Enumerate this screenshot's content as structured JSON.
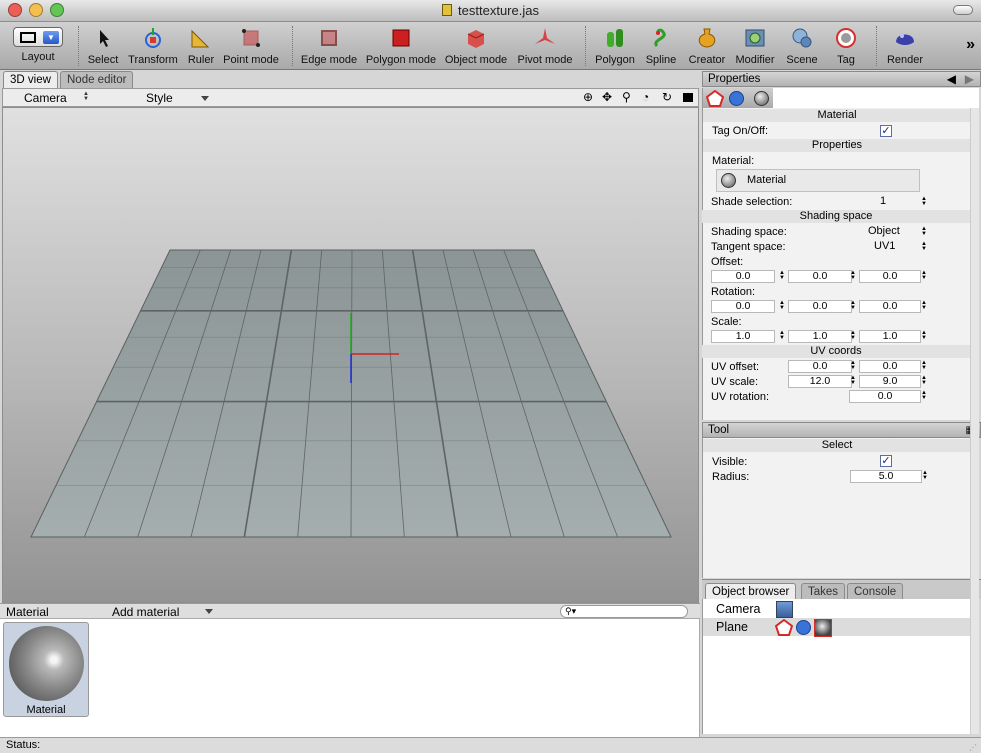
{
  "window": {
    "title": "testtexture.jas",
    "buttons": {
      "close_color": "#ec5f57",
      "minimize_color": "#f4bf4f",
      "zoom_color": "#62c554"
    }
  },
  "toolbar": {
    "items": [
      {
        "label": "Layout",
        "icon": "layout-icon"
      },
      {
        "label": "Select",
        "icon": "cursor-icon"
      },
      {
        "label": "Transform",
        "icon": "transform-icon"
      },
      {
        "label": "Ruler",
        "icon": "ruler-icon"
      },
      {
        "label": "Point mode",
        "icon": "point-mode-icon"
      },
      {
        "label": "Edge mode",
        "icon": "edge-mode-icon"
      },
      {
        "label": "Polygon mode",
        "icon": "polygon-mode-icon"
      },
      {
        "label": "Object mode",
        "icon": "object-mode-icon"
      },
      {
        "label": "Pivot mode",
        "icon": "pivot-mode-icon"
      },
      {
        "label": "Polygon",
        "icon": "polygon-icon"
      },
      {
        "label": "Spline",
        "icon": "spline-icon"
      },
      {
        "label": "Creator",
        "icon": "creator-icon"
      },
      {
        "label": "Modifier",
        "icon": "modifier-icon"
      },
      {
        "label": "Scene",
        "icon": "scene-icon"
      },
      {
        "label": "Tag",
        "icon": "tag-icon"
      },
      {
        "label": "Render",
        "icon": "render-icon"
      }
    ],
    "overflow": "»"
  },
  "left_tabs": {
    "view_3d": "3D view",
    "node_editor": "Node editor"
  },
  "view_header": {
    "camera": "Camera",
    "style": "Style"
  },
  "material_panel": {
    "header": "Material",
    "add": "Add material",
    "search_icon": "search-icon",
    "items": [
      {
        "label": "Material"
      }
    ]
  },
  "status": {
    "label": "Status:"
  },
  "properties": {
    "title": "Properties",
    "back_icon": "arrow-left-icon",
    "forward_icon": "arrow-right-icon",
    "sections": {
      "material": "Material",
      "properties": "Properties",
      "shading_space": "Shading space",
      "uv_coords": "UV coords"
    },
    "tag_onoff": "Tag On/Off:",
    "material_label": "Material:",
    "material_value": "Material",
    "shade_selection_label": "Shade selection:",
    "shade_selection_value": "1",
    "shading_space_label": "Shading space:",
    "shading_space_value": "Object",
    "tangent_space_label": "Tangent space:",
    "tangent_space_value": "UV1",
    "offset_label": "Offset:",
    "offset": [
      "0.0",
      "0.0",
      "0.0"
    ],
    "rotation_label": "Rotation:",
    "rotation": [
      "0.0",
      "0.0",
      "0.0"
    ],
    "scale_label": "Scale:",
    "scale": [
      "1.0",
      "1.0",
      "1.0"
    ],
    "uv_offset_label": "UV offset:",
    "uv_offset": [
      "0.0",
      "0.0"
    ],
    "uv_scale_label": "UV scale:",
    "uv_scale": [
      "12.0",
      "9.0"
    ],
    "uv_rotation_label": "UV rotation:",
    "uv_rotation": "0.0"
  },
  "tool": {
    "title": "Tool",
    "section": "Select",
    "visible_label": "Visible:",
    "radius_label": "Radius:",
    "radius_value": "5.0"
  },
  "object_browser": {
    "tabs": [
      "Object browser",
      "Takes",
      "Console"
    ],
    "rows": [
      {
        "name": "Camera"
      },
      {
        "name": "Plane"
      }
    ]
  },
  "colors": {
    "selection_row": "#dcdcdc",
    "axis_x": "#d62020",
    "axis_y": "#1fa81f",
    "axis_z": "#2030d0"
  }
}
